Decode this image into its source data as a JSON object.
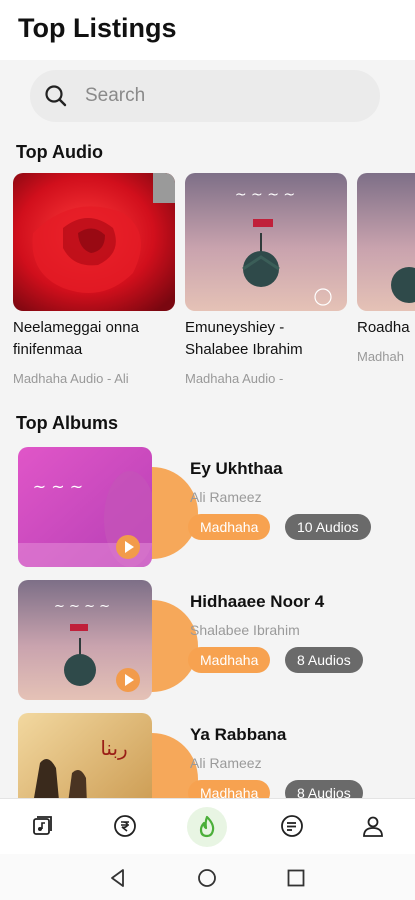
{
  "header": {
    "title": "Top Listings"
  },
  "search": {
    "placeholder": "Search"
  },
  "sections": {
    "audio_title": "Top Audio",
    "albums_title": "Top Albums"
  },
  "top_audio": [
    {
      "title_line1": "Neelameggai onna",
      "title_line2": "finifenmaa",
      "subtitle": "Madhaha Audio - Ali"
    },
    {
      "title_line1": "Emuneyshiey -",
      "title_line2": "Shalabee Ibrahim",
      "subtitle": "Madhaha Audio -"
    },
    {
      "title_line1": "Roadha",
      "title_line2": "",
      "subtitle": "Madhah"
    }
  ],
  "albums": [
    {
      "name": "Ey Ukhthaa",
      "artist": "Ali Rameez",
      "genre": "Madhaha",
      "count": "10 Audios"
    },
    {
      "name": "Hidhaaee Noor 4",
      "artist": "Shalabee Ibrahim",
      "genre": "Madhaha",
      "count": "8 Audios"
    },
    {
      "name": "Ya Rabbana",
      "artist": "Ali Rameez",
      "genre": "Madhaha",
      "count": "8 Audios"
    }
  ],
  "colors": {
    "accent": "#f7a250",
    "count_chip": "#6a6a6a",
    "active_tab": "#4caf3a"
  },
  "tabs": [
    {
      "icon": "music-library-icon"
    },
    {
      "icon": "rupee-coin-icon"
    },
    {
      "icon": "home-flame-icon",
      "active": true
    },
    {
      "icon": "playlist-icon"
    },
    {
      "icon": "profile-icon"
    }
  ]
}
